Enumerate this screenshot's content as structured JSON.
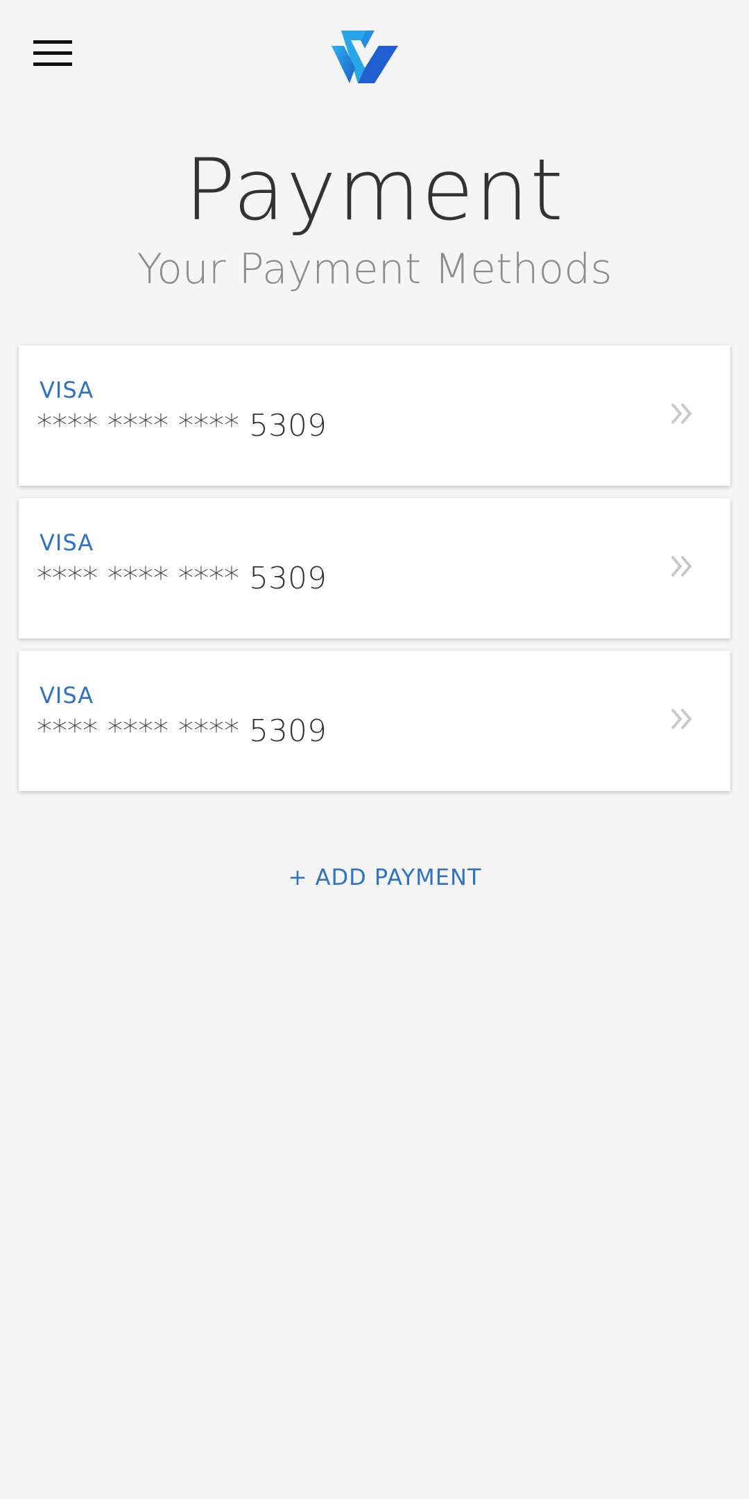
{
  "header": {
    "menu_icon": "hamburger-menu-icon",
    "logo_icon": "brand-logo-icon"
  },
  "page": {
    "title": "Payment",
    "subtitle": "Your Payment Methods"
  },
  "payment_methods": [
    {
      "brand": "VISA",
      "number": "**** **** **** 5309",
      "chevron_icon": "double-chevron-right-icon"
    },
    {
      "brand": "VISA",
      "number": "**** **** **** 5309",
      "chevron_icon": "double-chevron-right-icon"
    },
    {
      "brand": "VISA",
      "number": "**** **** **** 5309",
      "chevron_icon": "double-chevron-right-icon"
    }
  ],
  "actions": {
    "add_payment_label": "+ ADD PAYMENT"
  },
  "colors": {
    "background": "#f5f5f5",
    "accent": "#2f73c2",
    "text_dark": "#333333",
    "text_muted": "#8c8c8c",
    "chevron": "#c8c8c8",
    "logo_light": "#2aa6e8",
    "logo_dark": "#1f5fcf"
  }
}
